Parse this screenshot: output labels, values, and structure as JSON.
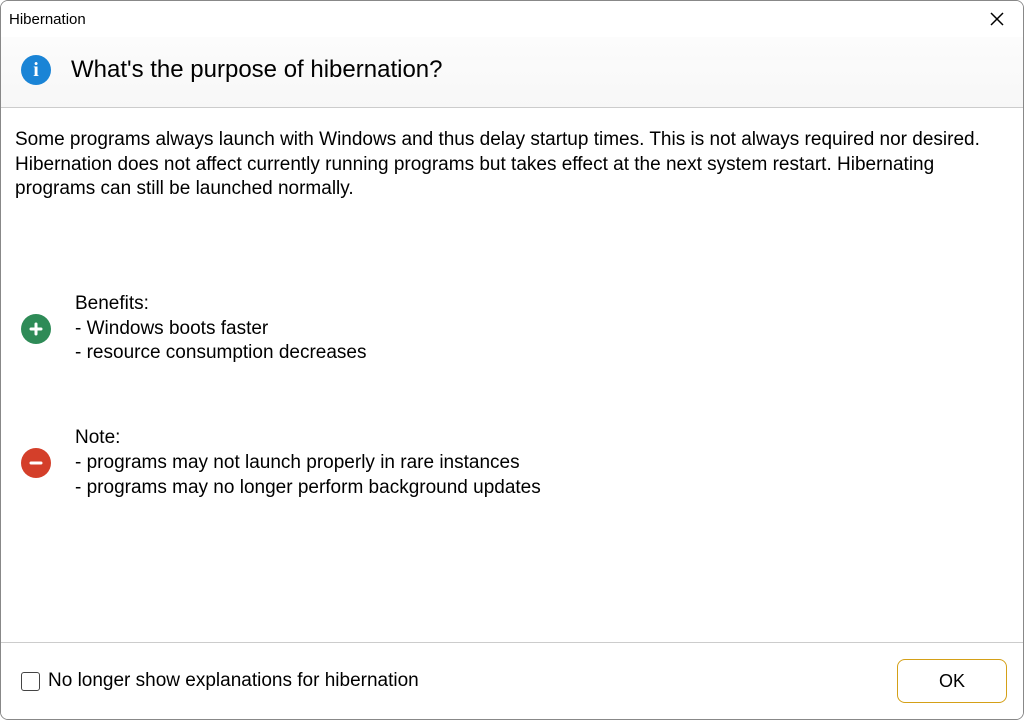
{
  "titlebar": {
    "title": "Hibernation"
  },
  "header": {
    "heading": "What's the purpose of hibernation?"
  },
  "body": {
    "description": "Some programs always launch with Windows and thus delay startup times. This is not always required nor desired. Hibernation does not affect currently running programs but takes effect at the next system restart. Hibernating programs can still be launched normally.",
    "benefits": "Benefits:\n- Windows boots faster\n- resource consumption decreases",
    "notes": "Note:\n- programs may not launch properly in rare instances\n- programs may no longer perform background updates"
  },
  "footer": {
    "checkbox_label": "No longer show explanations for hibernation",
    "ok_label": "OK"
  }
}
